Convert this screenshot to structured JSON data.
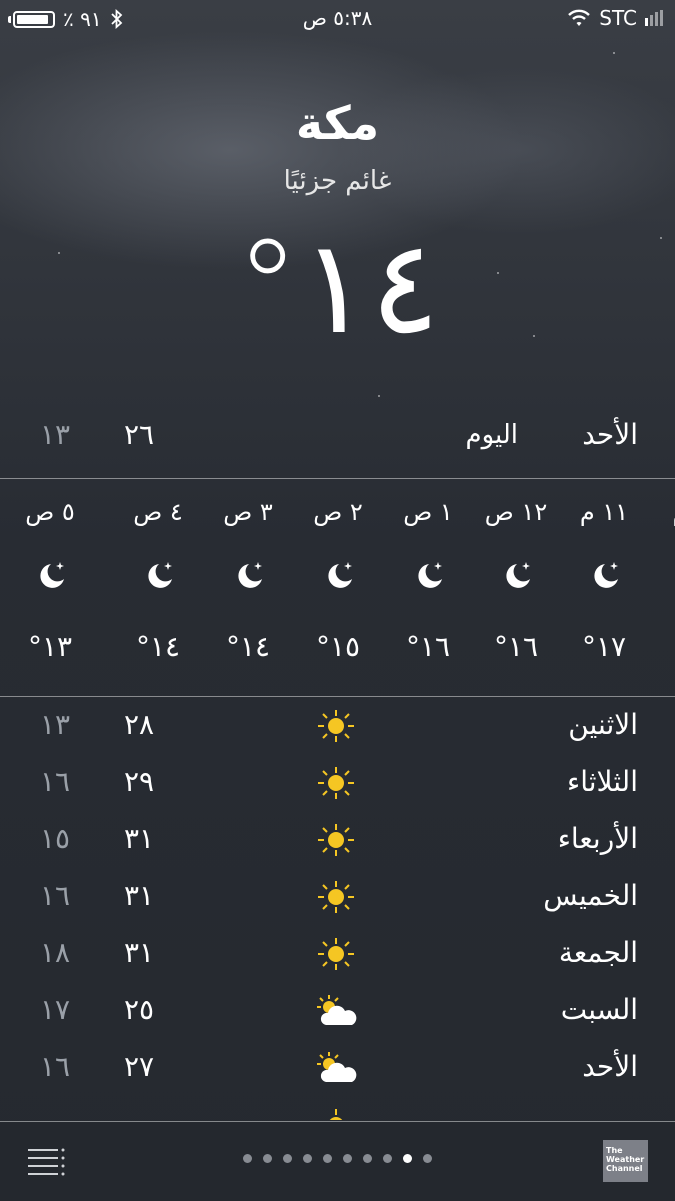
{
  "status_bar": {
    "carrier": "STC",
    "time": "٥:٣٨ ص",
    "battery": "٪ ٩١",
    "battery_level": 0.91
  },
  "location": {
    "city": "مكة",
    "condition": "غائم جزئيًا",
    "temperature": "١٤°"
  },
  "today": {
    "day": "الأحد",
    "label": "اليوم",
    "high": "٢٦",
    "low": "١٣"
  },
  "hourly": [
    {
      "hour": "م",
      "icon": "moon-icon",
      "temp": "°"
    },
    {
      "hour": "١١ م",
      "icon": "moon-icon",
      "temp": "°١٧"
    },
    {
      "hour": "١٢ ص",
      "icon": "moon-icon",
      "temp": "°١٦"
    },
    {
      "hour": "١ ص",
      "icon": "moon-icon",
      "temp": "°١٦"
    },
    {
      "hour": "٢ ص",
      "icon": "moon-icon",
      "temp": "°١٥"
    },
    {
      "hour": "٣ ص",
      "icon": "moon-icon",
      "temp": "°١٤"
    },
    {
      "hour": "٤ ص",
      "icon": "moon-icon",
      "temp": "°١٤"
    },
    {
      "hour": "٥ ص",
      "icon": "moon-icon",
      "temp": "°١٣"
    }
  ],
  "daily": [
    {
      "day": "الاثنين",
      "icon": "sun-icon",
      "high": "٢٨",
      "low": "١٣"
    },
    {
      "day": "الثلاثاء",
      "icon": "sun-icon",
      "high": "٢٩",
      "low": "١٦"
    },
    {
      "day": "الأربعاء",
      "icon": "sun-icon",
      "high": "٣١",
      "low": "١٥"
    },
    {
      "day": "الخميس",
      "icon": "sun-icon",
      "high": "٣١",
      "low": "١٦"
    },
    {
      "day": "الجمعة",
      "icon": "sun-icon",
      "high": "٣١",
      "low": "١٨"
    },
    {
      "day": "السبت",
      "icon": "partly-cloudy-icon",
      "high": "٢٥",
      "low": "١٧"
    },
    {
      "day": "الأحد",
      "icon": "partly-cloudy-icon",
      "high": "٢٧",
      "low": "١٦"
    },
    {
      "day": "",
      "icon": "sun-icon",
      "high": "",
      "low": ""
    }
  ],
  "pager": {
    "count": 10,
    "active_index": 8
  },
  "footer": {
    "brand": "The Weather Channel"
  },
  "colors": {
    "background": "#272b33",
    "sun": "#f5c623",
    "inactive_dot": "#888c93"
  }
}
